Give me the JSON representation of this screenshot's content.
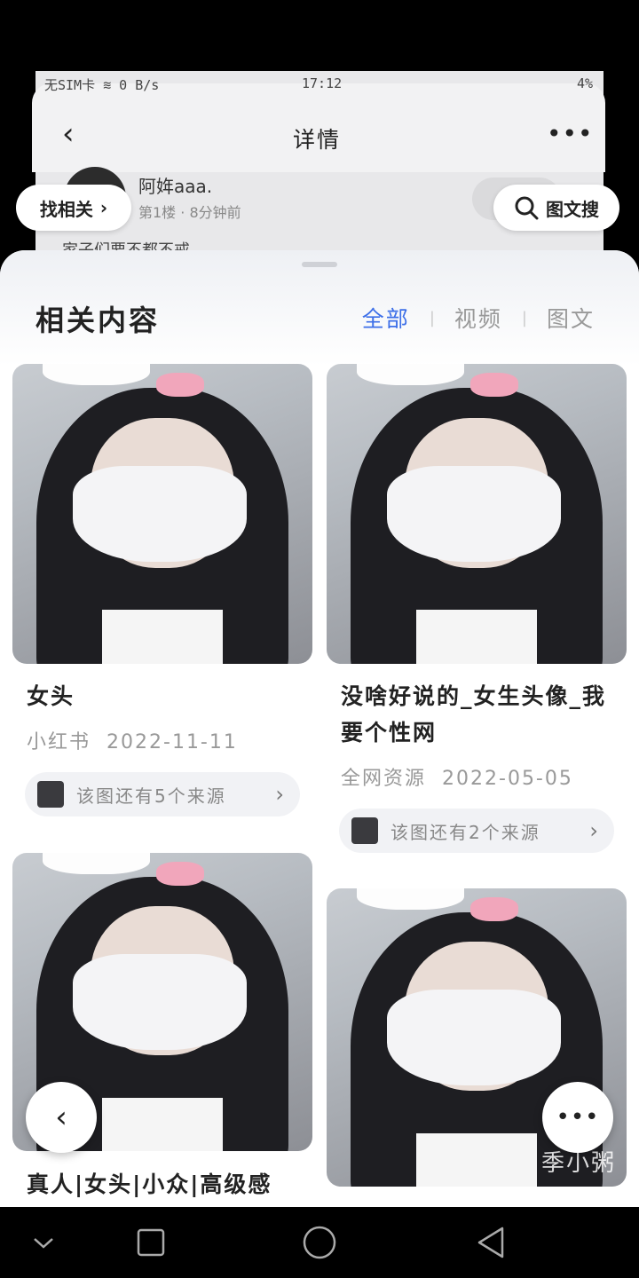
{
  "status_bar": {
    "left": "无SIM卡 ≋ 0 B/s",
    "time": "17:12",
    "right": "4%"
  },
  "background_page": {
    "title": "详情",
    "back_icon": "chevron-left-icon",
    "more_icon": "more-horizontal-icon",
    "user_name": "阿姩aaa.",
    "meta": "第1楼 · 8分钟前",
    "preview_text": "家子们要不都不戒"
  },
  "floating": {
    "find_related": "找相关",
    "image_search": "图文搜"
  },
  "sheet": {
    "title": "相关内容",
    "tabs": [
      {
        "label": "全部",
        "active": true
      },
      {
        "label": "视频",
        "active": false
      },
      {
        "label": "图文",
        "active": false
      }
    ]
  },
  "cards": [
    {
      "title": "女头",
      "source": "小红书",
      "date": "2022-11-11",
      "sources_note": "该图还有5个来源"
    },
    {
      "title": "没啥好说的_女生头像_我要个性网",
      "source": "全网资源",
      "date": "2022-05-05",
      "sources_note": "该图还有2个来源"
    },
    {
      "title": "真人|女头|小众|高级感"
    },
    {
      "watermark": "季小粥"
    }
  ],
  "nav": {
    "back": "back-icon",
    "home": "home-icon",
    "recents": "recents-icon",
    "down": "chevron-down-icon"
  }
}
